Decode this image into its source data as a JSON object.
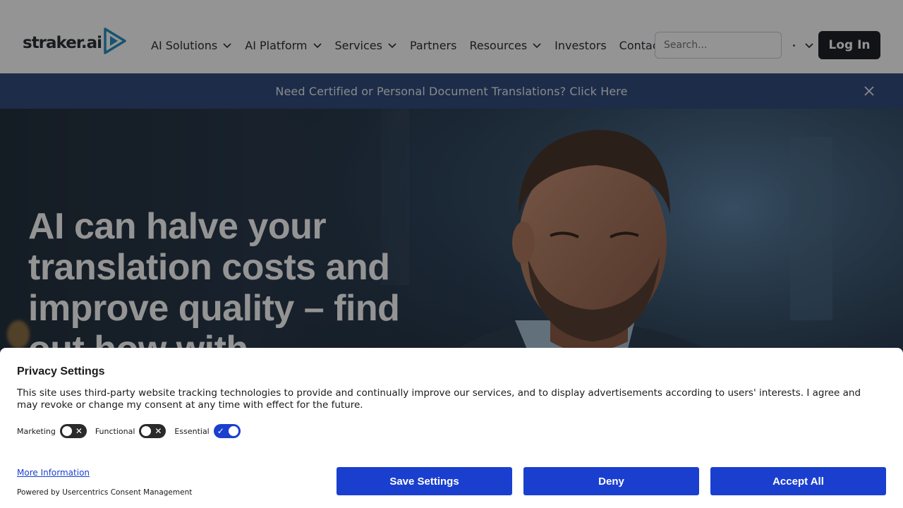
{
  "header": {
    "logo_text": "straker.ai",
    "nav": [
      {
        "label": "AI Solutions",
        "dropdown": true
      },
      {
        "label": "AI Platform",
        "dropdown": true
      },
      {
        "label": "Services",
        "dropdown": true
      },
      {
        "label": "Partners",
        "dropdown": false
      },
      {
        "label": "Resources",
        "dropdown": true
      },
      {
        "label": "Investors",
        "dropdown": false
      },
      {
        "label": "Contact",
        "dropdown": false
      }
    ],
    "search_placeholder": "Search...",
    "login_label": "Log In"
  },
  "banner": {
    "text": "Need Certified or Personal Document Translations? Click Here",
    "close_icon": "close-icon"
  },
  "hero": {
    "title": "AI can halve your translation costs and improve quality – find out how with"
  },
  "consent": {
    "title": "Privacy Settings",
    "text": "This site uses third-party website tracking technologies to provide and continually improve our services, and to display advertisements according to users' interests. I agree and may revoke or change my consent at any time with effect for the future.",
    "toggles": [
      {
        "label": "Marketing",
        "on": false
      },
      {
        "label": "Functional",
        "on": false
      },
      {
        "label": "Essential",
        "on": true
      }
    ],
    "more_info": "More Information",
    "powered_by": "Powered by Usercentrics Consent Management",
    "save_label": "Save Settings",
    "deny_label": "Deny",
    "accept_label": "Accept All"
  },
  "colors": {
    "brand_blue": "#1a3fcf",
    "banner_bg": "#324c7c",
    "login_bg": "#1f2228",
    "logo_teal": "#2a8fbf"
  }
}
